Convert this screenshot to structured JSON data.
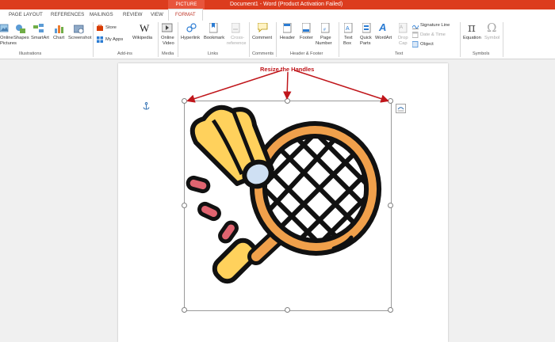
{
  "window": {
    "title": "Document1 - Word (Product Activation Failed)",
    "context_tab": "PICTURE TOOLS"
  },
  "tabs": [
    "PAGE LAYOUT",
    "REFERENCES",
    "MAILINGS",
    "REVIEW",
    "VIEW",
    "FORMAT"
  ],
  "ribbon": {
    "illustrations": {
      "online_pictures_1": "Online",
      "online_pictures_2": "Pictures",
      "shapes": "Shapes",
      "smartart": "SmartArt",
      "chart": "Chart",
      "screenshot": "Screenshot",
      "group": "Illustrations"
    },
    "addins": {
      "store": "Store",
      "my_apps": "My Apps",
      "wikipedia": "Wikipedia",
      "group": "Add-ins"
    },
    "media": {
      "online_video_1": "Online",
      "online_video_2": "Video",
      "group": "Media"
    },
    "links": {
      "hyperlink": "Hyperlink",
      "bookmark": "Bookmark",
      "cross_reference_1": "Cross-",
      "cross_reference_2": "reference",
      "group": "Links"
    },
    "comments": {
      "comment": "Comment",
      "group": "Comments"
    },
    "header_footer": {
      "header": "Header",
      "footer": "Footer",
      "page_number_1": "Page",
      "page_number_2": "Number",
      "group": "Header & Footer"
    },
    "text": {
      "text_box_1": "Text",
      "text_box_2": "Box",
      "quick_parts_1": "Quick",
      "quick_parts_2": "Parts",
      "wordart": "WordArt",
      "drop_cap_1": "Drop",
      "drop_cap_2": "Cap",
      "signature_line": "Signature Line",
      "date_time": "Date & Time",
      "object": "Object",
      "group": "Text"
    },
    "symbols": {
      "equation": "Equation",
      "symbol": "Symbol",
      "group": "Symbols"
    }
  },
  "annotation": {
    "callout": "Resize the Handles"
  },
  "colors": {
    "title_bar": "#dc3c1e",
    "annotation_red": "#c0161b",
    "racket_orange": "#f0a04b",
    "shuttle_yellow": "#ffd15c",
    "grip_yellow": "#ffd15c",
    "outline": "#111111",
    "pink_marks": "#e06470"
  }
}
